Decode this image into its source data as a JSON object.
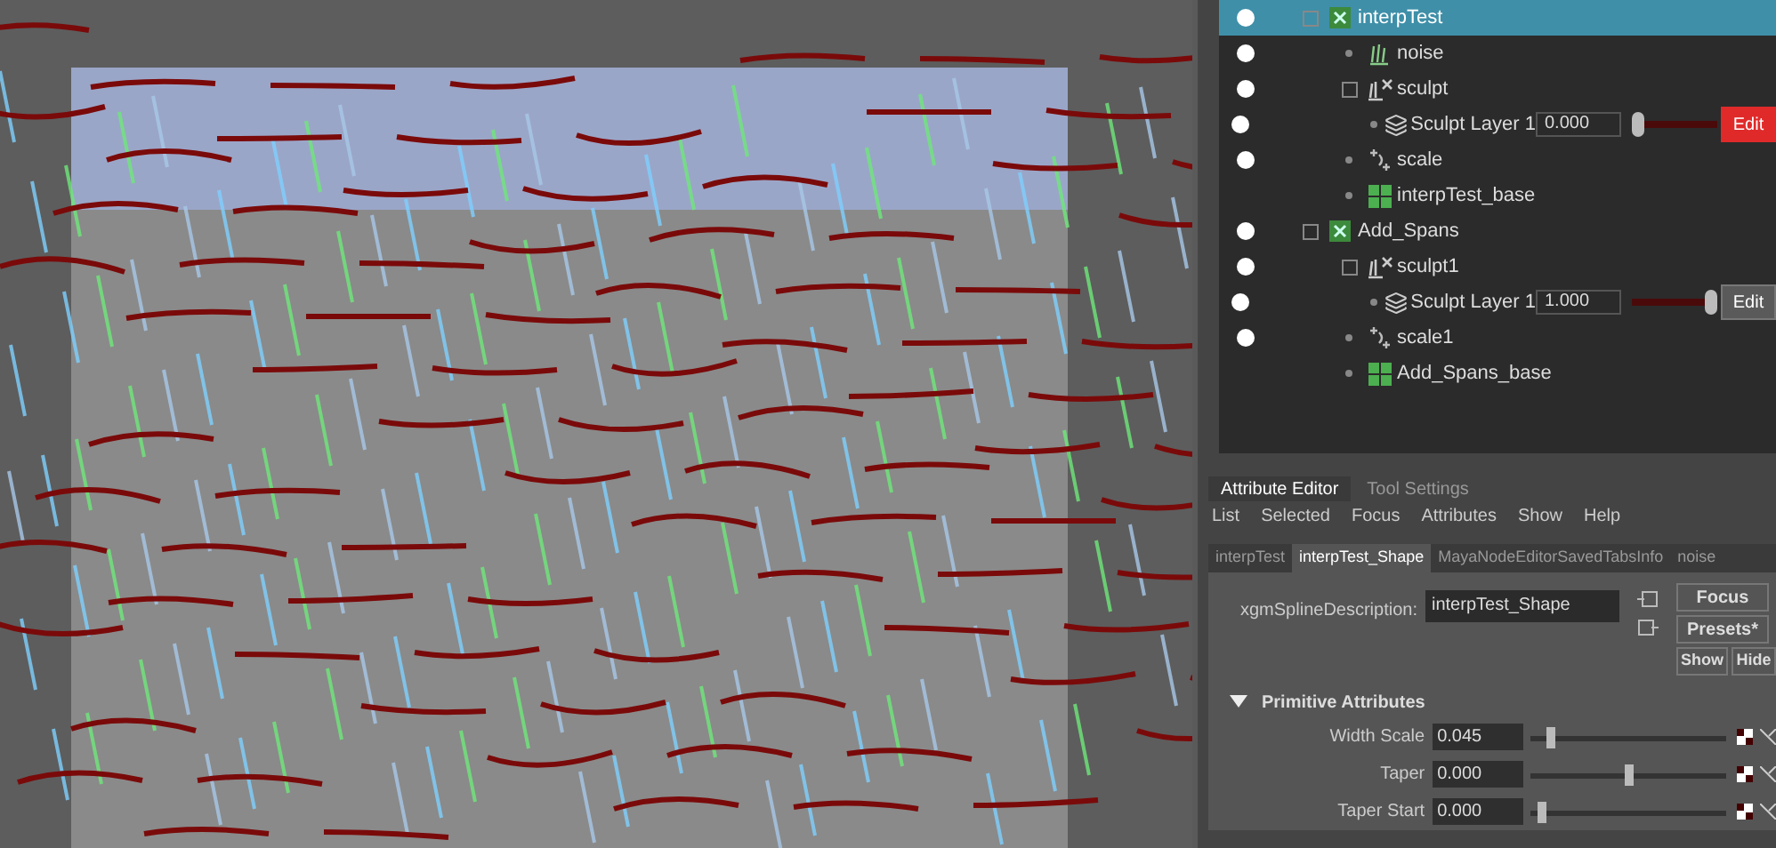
{
  "outliner": {
    "tree": [
      {
        "label": "interpTest",
        "kind": "description",
        "selected": true,
        "visible": true,
        "expanded": true,
        "children": [
          {
            "label": "noise",
            "kind": "modifier",
            "selected": false,
            "visible": true
          },
          {
            "label": "sculpt",
            "kind": "sculpt",
            "selected": false,
            "visible": true,
            "expanded": true,
            "children": [
              {
                "label": "Sculpt Layer 1",
                "kind": "layer",
                "selected": false,
                "visible": true,
                "value": "0.000",
                "level": 0,
                "edit_label": "Edit",
                "edit_active": true
              }
            ]
          },
          {
            "label": "scale",
            "kind": "scale",
            "selected": false,
            "visible": true
          },
          {
            "label": "interpTest_base",
            "kind": "base",
            "selected": false,
            "visible": false
          }
        ]
      },
      {
        "label": "Add_Spans",
        "kind": "description",
        "selected": false,
        "visible": true,
        "expanded": true,
        "children": [
          {
            "label": "sculpt1",
            "kind": "sculpt",
            "selected": false,
            "visible": true,
            "expanded": true,
            "children": [
              {
                "label": "Sculpt Layer 1",
                "kind": "layer",
                "selected": false,
                "visible": true,
                "value": "1.000",
                "level": 1,
                "edit_label": "Edit",
                "edit_active": false
              }
            ]
          },
          {
            "label": "scale1",
            "kind": "scale",
            "selected": false,
            "visible": true
          },
          {
            "label": "Add_Spans_base",
            "kind": "base",
            "selected": false,
            "visible": false
          }
        ]
      }
    ]
  },
  "attribute_editor": {
    "tabs": [
      {
        "label": "Attribute Editor",
        "selected": true
      },
      {
        "label": "Tool Settings",
        "selected": false
      }
    ],
    "menu": [
      "List",
      "Selected",
      "Focus",
      "Attributes",
      "Show",
      "Help"
    ],
    "node_tabs": [
      {
        "label": "interpTest",
        "selected": false
      },
      {
        "label": "interpTest_Shape",
        "selected": true
      },
      {
        "label": "MayaNodeEditorSavedTabsInfo",
        "selected": false
      },
      {
        "label": "noise",
        "selected": false
      }
    ],
    "node_field": {
      "label": "xgmSplineDescription:",
      "value": "interpTest_Shape"
    },
    "buttons": {
      "focus": "Focus",
      "presets": "Presets*",
      "show": "Show",
      "hide": "Hide"
    },
    "section": {
      "title": "Primitive Attributes",
      "expanded": true
    },
    "attributes": [
      {
        "label": "Width Scale",
        "value": "0.045",
        "level": 0.08
      },
      {
        "label": "Taper",
        "value": "0.000",
        "level": 0.5
      },
      {
        "label": "Taper Start",
        "value": "0.000",
        "level": 0.03
      }
    ]
  }
}
